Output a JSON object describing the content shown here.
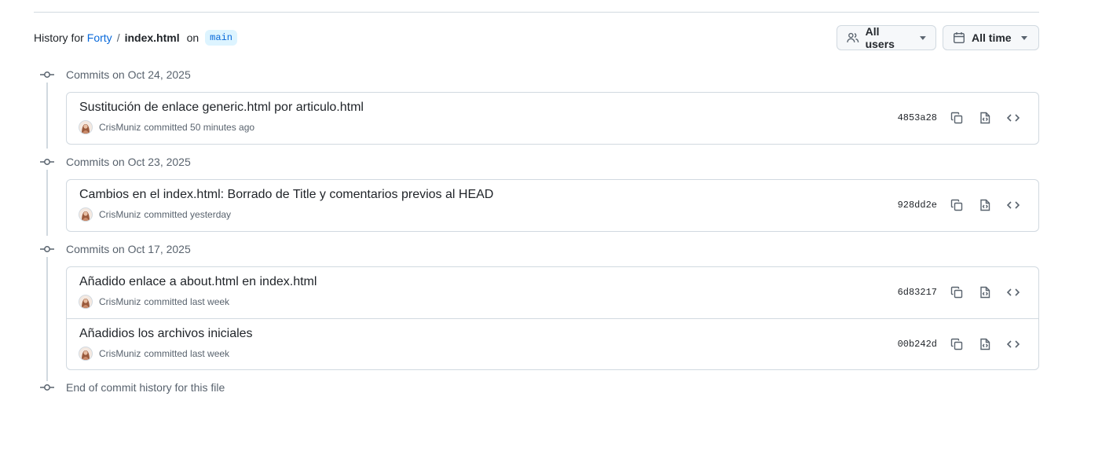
{
  "header": {
    "prefix": "History for",
    "repo": "Forty",
    "separator": "/",
    "file": "index.html",
    "on": "on",
    "branch": "main"
  },
  "filters": {
    "users_label": "All users",
    "time_label": "All time"
  },
  "groups": [
    {
      "label": "Commits on Oct 24, 2025",
      "commits": [
        {
          "message": "Sustitución de enlace generic.html por articulo.html",
          "author": "CrisMuniz",
          "action": "committed 50 minutes ago",
          "sha": "4853a28"
        }
      ]
    },
    {
      "label": "Commits on Oct 23, 2025",
      "commits": [
        {
          "message": "Cambios en el index.html: Borrado de Title y comentarios previos al HEAD",
          "author": "CrisMuniz",
          "action": "committed yesterday",
          "sha": "928dd2e"
        }
      ]
    },
    {
      "label": "Commits on Oct 17, 2025",
      "commits": [
        {
          "message": "Añadido enlace a about.html en index.html",
          "author": "CrisMuniz",
          "action": "committed last week",
          "sha": "6d83217"
        },
        {
          "message": "Añadidios los archivos iniciales",
          "author": "CrisMuniz",
          "action": "committed last week",
          "sha": "00b242d"
        }
      ]
    }
  ],
  "end_label": "End of commit history for this file",
  "icons": {
    "commit": "git-commit-icon",
    "users": "people-icon",
    "time": "calendar-icon",
    "copy": "copy-icon",
    "view_file": "file-code-icon",
    "browse": "code-icon"
  },
  "colors": {
    "link": "#0969da",
    "branch_bg": "#ddf4ff",
    "border": "#d1d9e0",
    "muted": "#59636e"
  }
}
